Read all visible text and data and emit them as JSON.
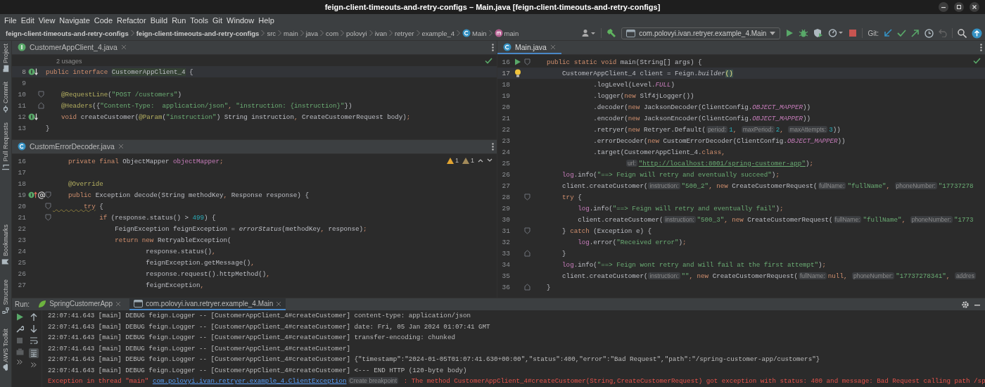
{
  "window": {
    "title": "feign-client-timeouts-and-retry-configs – Main.java [feign-client-timeouts-and-retry-configs]"
  },
  "menu": [
    "File",
    "Edit",
    "View",
    "Navigate",
    "Code",
    "Refactor",
    "Build",
    "Run",
    "Tools",
    "Git",
    "Window",
    "Help"
  ],
  "breadcrumbs": [
    {
      "kind": "project",
      "text": "feign-client-timeouts-and-retry-configs"
    },
    {
      "kind": "module",
      "text": "feign-client-timeouts-and-retry-configs"
    },
    {
      "kind": "folder",
      "text": "src"
    },
    {
      "kind": "folder",
      "text": "main"
    },
    {
      "kind": "folder",
      "text": "java"
    },
    {
      "kind": "folder",
      "text": "com"
    },
    {
      "kind": "folder",
      "text": "polovyi"
    },
    {
      "kind": "folder",
      "text": "ivan"
    },
    {
      "kind": "folder",
      "text": "retryer"
    },
    {
      "kind": "folder",
      "text": "example_4"
    },
    {
      "kind": "class",
      "text": "Main"
    },
    {
      "kind": "method",
      "text": "main"
    }
  ],
  "toolbar": {
    "run_config": "com.polovyi.ivan.retryer.example_4.Main",
    "git_label": "Git:"
  },
  "side_tools": [
    {
      "label": "Project"
    },
    {
      "label": "Commit"
    },
    {
      "label": "Pull Requests"
    },
    {
      "label": "Bookmarks"
    },
    {
      "label": "Structure"
    },
    {
      "label": "AWS Toolkit"
    }
  ],
  "editor_groups": [
    {
      "panes": [
        {
          "tab": {
            "label": "CustomerAppClient_4.java",
            "kind": "interface",
            "selected": false
          },
          "usages": "2 usages",
          "inspection": {
            "kind": "ok"
          },
          "lines": [
            {
              "number": "8",
              "gutter_icons": [
                {
                  "kind": "implemented"
                }
              ],
              "current": true,
              "code": [
                {
                  "kind": "kw",
                  "text": "public "
                },
                {
                  "kind": "kw",
                  "text": "interface "
                },
                {
                  "kind": "cls",
                  "text": "CustomerAppClient_4"
                },
                {
                  "kind": "plain",
                  "text": " {"
                }
              ]
            },
            {
              "number": "9",
              "current": false
            },
            {
              "number": "10",
              "gutter_icons": [
                {
                  "kind": "fold-start"
                }
              ],
              "current": false,
              "code": [
                {
                  "kind": "ann",
                  "text": "    @RequestLine"
                },
                {
                  "kind": "plain",
                  "text": "("
                },
                {
                  "kind": "str",
                  "text": "\"POST /customers\""
                },
                {
                  "kind": "plain",
                  "text": ")"
                }
              ]
            },
            {
              "number": "11",
              "gutter_icons": [
                {
                  "kind": "fold-end"
                }
              ],
              "current": false,
              "code": [
                {
                  "kind": "ann",
                  "text": "    @Headers"
                },
                {
                  "kind": "plain",
                  "text": "({"
                },
                {
                  "kind": "str",
                  "text": "\"Content-Type:  application/json\""
                },
                {
                  "kind": "kw",
                  "text": ", "
                },
                {
                  "kind": "str",
                  "text": "\"instruction: {instruction}\""
                },
                {
                  "kind": "plain",
                  "text": "})"
                }
              ]
            },
            {
              "number": "12",
              "gutter_icons": [
                {
                  "kind": "implemented"
                }
              ],
              "current": false,
              "code": [
                {
                  "kind": "kw",
                  "text": "    void "
                },
                {
                  "kind": "plain",
                  "text": "createCustomer("
                },
                {
                  "kind": "ann",
                  "text": "@Param"
                },
                {
                  "kind": "plain",
                  "text": "("
                },
                {
                  "kind": "str",
                  "text": "\"instruction\""
                },
                {
                  "kind": "plain",
                  "text": ") String instruction"
                },
                {
                  "kind": "kw",
                  "text": ", "
                },
                {
                  "kind": "plain",
                  "text": "CreateCustomerRequest body)"
                },
                {
                  "kind": "kw",
                  "text": ";"
                }
              ]
            },
            {
              "number": "13",
              "current": false,
              "code": [
                {
                  "kind": "plain",
                  "text": "}"
                }
              ]
            }
          ]
        },
        {
          "tab": {
            "label": "CustomErrorDecoder.java",
            "kind": "class",
            "selected": false
          },
          "inspection": {
            "kind": "issues",
            "items": [
              {
                "kind": "warning",
                "count": "1"
              },
              {
                "kind": "weak",
                "count": "1"
              }
            ]
          },
          "lines": [
            {
              "number": "16",
              "current": false,
              "code": [
                {
                  "kind": "kw",
                  "text": "    private final "
                },
                {
                  "kind": "plain",
                  "text": "ObjectMapper "
                },
                {
                  "kind": "field",
                  "text": "objectMapper"
                },
                {
                  "kind": "kw",
                  "text": ";"
                }
              ]
            },
            {
              "number": "17",
              "current": false
            },
            {
              "number": "18",
              "current": false,
              "code": [
                {
                  "kind": "ann",
                  "text": "    @Override"
                }
              ]
            },
            {
              "number": "19",
              "gutter_icons": [
                {
                  "kind": "override"
                },
                {
                  "kind": "annotation"
                },
                {
                  "kind": "fold-start"
                }
              ],
              "current": false,
              "code": [
                {
                  "kind": "kw",
                  "text": "    public "
                },
                {
                  "kind": "plain",
                  "text": "Exception decode(String methodKey"
                },
                {
                  "kind": "kw",
                  "text": ", "
                },
                {
                  "kind": "plain",
                  "text": "Response response) {"
                }
              ]
            },
            {
              "number": "20",
              "gutter_icons": [
                {
                  "kind": "fold-start"
                }
              ],
              "current": false,
              "code": [
                {
                  "kind": "kw-warn",
                  "text": "        try"
                },
                {
                  "kind": "plain",
                  "text": " {"
                }
              ]
            },
            {
              "number": "21",
              "gutter_icons": [
                {
                  "kind": "fold-start"
                }
              ],
              "current": false,
              "code": [
                {
                  "kind": "kw",
                  "text": "            if "
                },
                {
                  "kind": "plain",
                  "text": "(response.status() > "
                },
                {
                  "kind": "num",
                  "text": "499"
                },
                {
                  "kind": "plain",
                  "text": ") {"
                }
              ]
            },
            {
              "number": "22",
              "current": false,
              "code": [
                {
                  "kind": "plain",
                  "text": "                FeignException feignException = "
                },
                {
                  "kind": "italic",
                  "text": "errorStatus"
                },
                {
                  "kind": "plain",
                  "text": "(methodKey"
                },
                {
                  "kind": "kw",
                  "text": ", "
                },
                {
                  "kind": "plain",
                  "text": "response)"
                },
                {
                  "kind": "kw",
                  "text": ";"
                }
              ]
            },
            {
              "number": "23",
              "current": false,
              "code": [
                {
                  "kind": "kw",
                  "text": "                return new "
                },
                {
                  "kind": "plain",
                  "text": "RetryableException("
                }
              ]
            },
            {
              "number": "24",
              "current": false,
              "code": [
                {
                  "kind": "plain",
                  "text": "                        response.status()"
                },
                {
                  "kind": "kw",
                  "text": ","
                }
              ]
            },
            {
              "number": "25",
              "current": false,
              "code": [
                {
                  "kind": "plain",
                  "text": "                        feignException.getMessage()"
                },
                {
                  "kind": "kw",
                  "text": ","
                }
              ]
            },
            {
              "number": "26",
              "current": false,
              "code": [
                {
                  "kind": "plain",
                  "text": "                        response.request().httpMethod()"
                },
                {
                  "kind": "kw",
                  "text": ","
                }
              ]
            },
            {
              "number": "27",
              "current": false,
              "code": [
                {
                  "kind": "plain",
                  "text": "                        feignException"
                },
                {
                  "kind": "kw",
                  "text": ","
                }
              ]
            }
          ]
        }
      ]
    },
    {
      "panes": [
        {
          "tab": {
            "label": "Main.java",
            "kind": "class",
            "selected": true
          },
          "inspection": {
            "kind": "ok"
          },
          "lines": [
            {
              "number": "16",
              "gutter_icons": [
                {
                  "kind": "run"
                },
                {
                  "kind": "fold-start"
                }
              ],
              "current": false,
              "code": [
                {
                  "kind": "kw",
                  "text": "    public static void "
                },
                {
                  "kind": "plain",
                  "text": "main(String[] args) {"
                }
              ]
            },
            {
              "number": "17",
              "gutter_icons": [
                {
                  "kind": "bulb"
                }
              ],
              "current": true,
              "code": [
                {
                  "kind": "plain",
                  "text": "        CustomerAppClient_4 client = Feign."
                },
                {
                  "kind": "italic",
                  "text": "builder"
                },
                {
                  "kind": "match",
                  "text": "()"
                }
              ]
            },
            {
              "number": "18",
              "current": false,
              "code": [
                {
                  "kind": "plain",
                  "text": "                .logLevel(Level."
                },
                {
                  "kind": "const",
                  "text": "FULL"
                },
                {
                  "kind": "plain",
                  "text": ")"
                }
              ]
            },
            {
              "number": "19",
              "current": false,
              "code": [
                {
                  "kind": "plain",
                  "text": "                .logger("
                },
                {
                  "kind": "kw",
                  "text": "new "
                },
                {
                  "kind": "plain",
                  "text": "Slf4jLogger())"
                }
              ]
            },
            {
              "number": "20",
              "current": false,
              "code": [
                {
                  "kind": "plain",
                  "text": "                .decoder("
                },
                {
                  "kind": "kw",
                  "text": "new "
                },
                {
                  "kind": "plain",
                  "text": "JacksonDecoder(ClientConfig."
                },
                {
                  "kind": "const",
                  "text": "OBJECT_MAPPER"
                },
                {
                  "kind": "plain",
                  "text": "))"
                }
              ]
            },
            {
              "number": "21",
              "current": false,
              "code": [
                {
                  "kind": "plain",
                  "text": "                .encoder("
                },
                {
                  "kind": "kw",
                  "text": "new "
                },
                {
                  "kind": "plain",
                  "text": "JacksonEncoder(ClientConfig."
                },
                {
                  "kind": "const",
                  "text": "OBJECT_MAPPER"
                },
                {
                  "kind": "plain",
                  "text": "))"
                }
              ]
            },
            {
              "number": "22",
              "current": false,
              "code": [
                {
                  "kind": "plain",
                  "text": "                .retryer("
                },
                {
                  "kind": "kw",
                  "text": "new "
                },
                {
                  "kind": "plain",
                  "text": "Retryer.Default("
                },
                {
                  "kind": "hint",
                  "text": "period:"
                },
                {
                  "kind": "num",
                  "text": "1"
                },
                {
                  "kind": "kw",
                  "text": ", "
                },
                {
                  "kind": "hint",
                  "text": "maxPeriod:"
                },
                {
                  "kind": "num",
                  "text": "2"
                },
                {
                  "kind": "kw",
                  "text": ", "
                },
                {
                  "kind": "hint",
                  "text": "maxAttempts:"
                },
                {
                  "kind": "num",
                  "text": "3"
                },
                {
                  "kind": "plain",
                  "text": "))"
                }
              ]
            },
            {
              "number": "23",
              "current": false,
              "code": [
                {
                  "kind": "plain",
                  "text": "                .errorDecoder("
                },
                {
                  "kind": "kw",
                  "text": "new "
                },
                {
                  "kind": "plain",
                  "text": "CustomErrorDecoder(ClientConfig."
                },
                {
                  "kind": "const",
                  "text": "OBJECT_MAPPER"
                },
                {
                  "kind": "plain",
                  "text": "))"
                }
              ]
            },
            {
              "number": "24",
              "current": false,
              "code": [
                {
                  "kind": "plain",
                  "text": "                .target(CustomerAppClient_4."
                },
                {
                  "kind": "kw",
                  "text": "class,"
                }
              ]
            },
            {
              "number": "25",
              "current": false,
              "code": [
                {
                  "kind": "hint-indented",
                  "text": "url:"
                },
                {
                  "kind": "link",
                  "text": "\"http://localhost:8001/spring-customer-app\""
                },
                {
                  "kind": "plain",
                  "text": ")"
                },
                {
                  "kind": "kw",
                  "text": ";"
                }
              ]
            },
            {
              "number": "26",
              "current": false,
              "code": [
                {
                  "kind": "field",
                  "text": "        log"
                },
                {
                  "kind": "plain",
                  "text": ".info("
                },
                {
                  "kind": "str",
                  "text": "\"==> Feign will retry and eventually succeed\""
                },
                {
                  "kind": "plain",
                  "text": ")"
                },
                {
                  "kind": "kw",
                  "text": ";"
                }
              ]
            },
            {
              "number": "27",
              "current": false,
              "code": [
                {
                  "kind": "plain",
                  "text": "        client.createCustomer("
                },
                {
                  "kind": "hint",
                  "text": "instruction:"
                },
                {
                  "kind": "str",
                  "text": "\"500_2\""
                },
                {
                  "kind": "kw",
                  "text": ", new "
                },
                {
                  "kind": "plain",
                  "text": "CreateCustomerRequest("
                },
                {
                  "kind": "hint",
                  "text": "fullName:"
                },
                {
                  "kind": "str",
                  "text": "\"fullName\""
                },
                {
                  "kind": "kw",
                  "text": ", "
                },
                {
                  "kind": "hint",
                  "text": "phoneNumber:"
                },
                {
                  "kind": "str",
                  "text": "\"17737278"
                }
              ]
            },
            {
              "number": "28",
              "gutter_icons": [
                {
                  "kind": "fold-start"
                }
              ],
              "current": false,
              "code": [
                {
                  "kind": "kw",
                  "text": "        try"
                },
                {
                  "kind": "plain",
                  "text": " {"
                }
              ]
            },
            {
              "number": "29",
              "current": false,
              "code": [
                {
                  "kind": "field",
                  "text": "            log"
                },
                {
                  "kind": "plain",
                  "text": ".info("
                },
                {
                  "kind": "str",
                  "text": "\"==> Feign will retry and eventually fail\""
                },
                {
                  "kind": "plain",
                  "text": ")"
                },
                {
                  "kind": "kw",
                  "text": ";"
                }
              ]
            },
            {
              "number": "30",
              "current": false,
              "code": [
                {
                  "kind": "plain",
                  "text": "            client.createCustomer("
                },
                {
                  "kind": "hint",
                  "text": "instruction:"
                },
                {
                  "kind": "str",
                  "text": "\"500_3\""
                },
                {
                  "kind": "kw",
                  "text": ", new "
                },
                {
                  "kind": "plain",
                  "text": "CreateCustomerRequest("
                },
                {
                  "kind": "hint",
                  "text": "fullName:"
                },
                {
                  "kind": "str",
                  "text": "\"fullName\""
                },
                {
                  "kind": "kw",
                  "text": ", "
                },
                {
                  "kind": "hint",
                  "text": "phoneNumber:"
                },
                {
                  "kind": "str",
                  "text": "\"1773"
                }
              ]
            },
            {
              "number": "31",
              "gutter_icons": [
                {
                  "kind": "fold-start"
                }
              ],
              "current": false,
              "code": [
                {
                  "kind": "plain",
                  "text": "        } "
                },
                {
                  "kind": "kw",
                  "text": "catch "
                },
                {
                  "kind": "plain",
                  "text": "(Exception e) {"
                }
              ]
            },
            {
              "number": "32",
              "current": false,
              "code": [
                {
                  "kind": "field",
                  "text": "            log"
                },
                {
                  "kind": "plain",
                  "text": ".error("
                },
                {
                  "kind": "str",
                  "text": "\"Received error\""
                },
                {
                  "kind": "plain",
                  "text": ")"
                },
                {
                  "kind": "kw",
                  "text": ";"
                }
              ]
            },
            {
              "number": "33",
              "gutter_icons": [
                {
                  "kind": "fold-end"
                }
              ],
              "current": false,
              "code": [
                {
                  "kind": "plain",
                  "text": "        }"
                }
              ]
            },
            {
              "number": "34",
              "current": false,
              "code": [
                {
                  "kind": "field",
                  "text": "        log"
                },
                {
                  "kind": "plain",
                  "text": ".info("
                },
                {
                  "kind": "str",
                  "text": "\"==> Feign wont retry and will fail at the first attempt\""
                },
                {
                  "kind": "plain",
                  "text": ")"
                },
                {
                  "kind": "kw",
                  "text": ";"
                }
              ]
            },
            {
              "number": "35",
              "current": false,
              "code": [
                {
                  "kind": "plain",
                  "text": "        client.createCustomer("
                },
                {
                  "kind": "hint",
                  "text": "instruction:"
                },
                {
                  "kind": "str",
                  "text": "\"\""
                },
                {
                  "kind": "kw",
                  "text": ", new "
                },
                {
                  "kind": "plain",
                  "text": "CreateCustomerRequest("
                },
                {
                  "kind": "hint",
                  "text": "fullName:"
                },
                {
                  "kind": "kw",
                  "text": "null, "
                },
                {
                  "kind": "hint",
                  "text": "phoneNumber:"
                },
                {
                  "kind": "str",
                  "text": "\"17737278341\""
                },
                {
                  "kind": "kw",
                  "text": ", "
                },
                {
                  "kind": "hint",
                  "text": "addres"
                }
              ]
            },
            {
              "number": "36",
              "gutter_icons": [
                {
                  "kind": "fold-end"
                }
              ],
              "current": false,
              "code": [
                {
                  "kind": "plain",
                  "text": "    }"
                }
              ]
            }
          ]
        }
      ]
    }
  ],
  "run": {
    "label": "Run:",
    "tabs": [
      {
        "label": "SpringCustomerApp",
        "kind": "spring",
        "selected": false
      },
      {
        "label": "com.polovyi.ivan.retryer.example_4.Main",
        "kind": "app",
        "selected": true
      }
    ],
    "log": [
      {
        "kind": "info",
        "parts": [
          {
            "kind": "text",
            "text": "22:07:41.643 [main] DEBUG feign.Logger -- [CustomerAppClient_4#createCustomer] content-type: application/json"
          }
        ]
      },
      {
        "kind": "info",
        "parts": [
          {
            "kind": "text",
            "text": "22:07:41.643 [main] DEBUG feign.Logger -- [CustomerAppClient_4#createCustomer] date: Fri, 05 Jan 2024 01:07:41 GMT"
          }
        ]
      },
      {
        "kind": "info",
        "parts": [
          {
            "kind": "text",
            "text": "22:07:41.643 [main] DEBUG feign.Logger -- [CustomerAppClient_4#createCustomer] transfer-encoding: chunked"
          }
        ]
      },
      {
        "kind": "info",
        "parts": [
          {
            "kind": "text",
            "text": "22:07:41.643 [main] DEBUG feign.Logger -- [CustomerAppClient_4#createCustomer]"
          }
        ]
      },
      {
        "kind": "info",
        "parts": [
          {
            "kind": "text",
            "text": "22:07:41.643 [main] DEBUG feign.Logger -- [CustomerAppClient_4#createCustomer] {\"timestamp\":\"2024-01-05T01:07:41.630+00:00\",\"status\":400,\"error\":\"Bad Request\",\"path\":\"/spring-customer-app/customers\"}"
          }
        ]
      },
      {
        "kind": "info",
        "parts": [
          {
            "kind": "text",
            "text": "22:07:41.643 [main] DEBUG feign.Logger -- [CustomerAppClient_4#createCustomer] <--- END HTTP (120-byte body)"
          }
        ]
      },
      {
        "kind": "error",
        "parts": [
          {
            "kind": "text",
            "text": "Exception in thread \"main\" "
          },
          {
            "kind": "link",
            "text": "com.polovyi.ivan.retryer.example_4.ClientException"
          },
          {
            "kind": "hint",
            "text": "Create breakpoint"
          },
          {
            "kind": "text",
            "text": " : The method CustomerAppClient_4#createCustomer(String,CreateCustomerRequest) got exception with status: 400 and message: Bad Request calling path /sp"
          }
        ]
      }
    ]
  }
}
